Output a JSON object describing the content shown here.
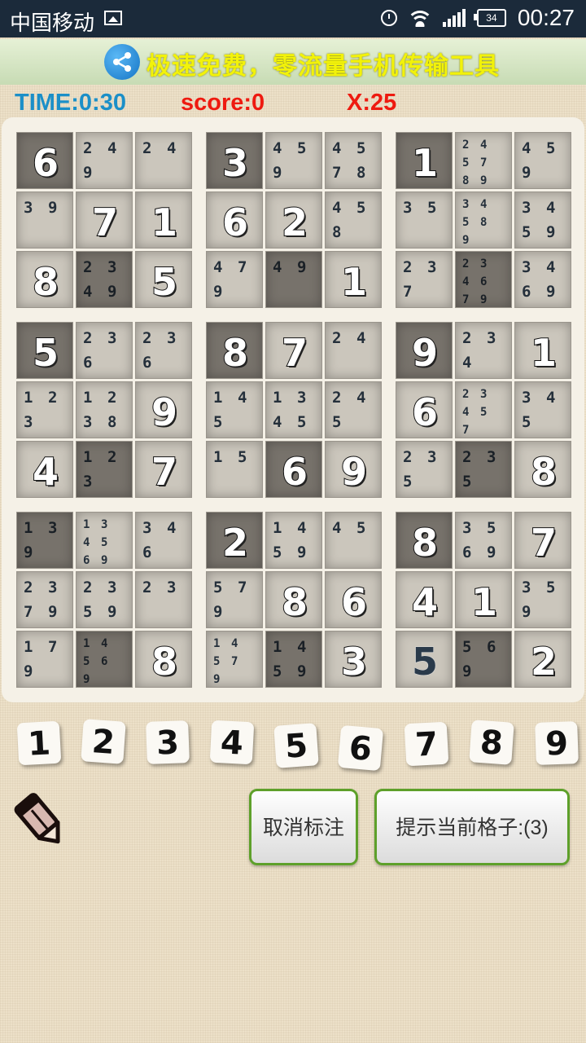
{
  "status_bar": {
    "carrier": "中国移动",
    "battery": "34",
    "time": "00:27",
    "icons": [
      "picture-icon",
      "alarm-clock-icon",
      "wifi-icon",
      "signal-icon",
      "battery-icon"
    ]
  },
  "banner": {
    "text": "极速免费，零流量手机传输工具",
    "icon": "share-icon",
    "text_color": "#f2f20a"
  },
  "hud": {
    "time": "TIME:0:30",
    "score": "score:0",
    "x": "X:25",
    "time_color": "#1b8fc8",
    "score_color": "#ee1a10"
  },
  "board": {
    "blocks": [
      [
        {
          "v": "6"
        },
        {
          "n": [
            "2",
            "4",
            "9"
          ]
        },
        {
          "n": [
            "2",
            "4"
          ]
        },
        {
          "n": [
            "3",
            "9"
          ]
        },
        {
          "v": "7"
        },
        {
          "v": "1"
        },
        {
          "v": "8"
        },
        {
          "n": [
            "2",
            "3",
            "4",
            "9"
          ]
        },
        {
          "v": "5"
        }
      ],
      [
        {
          "v": "3"
        },
        {
          "n": [
            "4",
            "5",
            "9"
          ]
        },
        {
          "n": [
            "4",
            "5",
            "7",
            "8"
          ]
        },
        {
          "v": "6"
        },
        {
          "v": "2"
        },
        {
          "n": [
            "4",
            "5",
            "8"
          ]
        },
        {
          "n": [
            "4",
            "7",
            "9"
          ]
        },
        {
          "n": [
            "4",
            "9"
          ]
        },
        {
          "v": "1"
        }
      ],
      [
        {
          "v": "1"
        },
        {
          "n": [
            "2",
            "4",
            "5",
            "7",
            "8",
            "9"
          ]
        },
        {
          "n": [
            "4",
            "5",
            "9"
          ]
        },
        {
          "n": [
            "3",
            "5"
          ]
        },
        {
          "n": [
            "3",
            "4",
            "5",
            "8",
            "9"
          ]
        },
        {
          "n": [
            "3",
            "4",
            "5",
            "9"
          ]
        },
        {
          "n": [
            "2",
            "3",
            "7"
          ]
        },
        {
          "n": [
            "2",
            "3",
            "4",
            "6",
            "7",
            "9"
          ]
        },
        {
          "n": [
            "3",
            "4",
            "6",
            "9"
          ]
        }
      ],
      [
        {
          "v": "5"
        },
        {
          "n": [
            "2",
            "3",
            "6"
          ]
        },
        {
          "n": [
            "2",
            "3",
            "6"
          ]
        },
        {
          "n": [
            "1",
            "2",
            "3"
          ]
        },
        {
          "n": [
            "1",
            "2",
            "3",
            "8"
          ]
        },
        {
          "v": "9"
        },
        {
          "v": "4"
        },
        {
          "n": [
            "1",
            "2",
            "3"
          ]
        },
        {
          "v": "7"
        }
      ],
      [
        {
          "v": "8"
        },
        {
          "v": "7"
        },
        {
          "n": [
            "2",
            "4"
          ]
        },
        {
          "n": [
            "1",
            "4",
            "5"
          ]
        },
        {
          "n": [
            "1",
            "3",
            "4",
            "5"
          ]
        },
        {
          "n": [
            "2",
            "4",
            "5"
          ]
        },
        {
          "n": [
            "1",
            "5"
          ]
        },
        {
          "v": "6"
        },
        {
          "v": "9"
        }
      ],
      [
        {
          "v": "9"
        },
        {
          "n": [
            "2",
            "3",
            "4"
          ]
        },
        {
          "v": "1"
        },
        {
          "v": "6"
        },
        {
          "n": [
            "2",
            "3",
            "4",
            "5",
            "7"
          ]
        },
        {
          "n": [
            "3",
            "4",
            "5"
          ]
        },
        {
          "n": [
            "2",
            "3",
            "5"
          ]
        },
        {
          "n": [
            "2",
            "3",
            "5"
          ]
        },
        {
          "v": "8"
        }
      ],
      [
        {
          "n": [
            "1",
            "3",
            "9"
          ]
        },
        {
          "n": [
            "1",
            "3",
            "4",
            "5",
            "6",
            "9"
          ]
        },
        {
          "n": [
            "3",
            "4",
            "6"
          ]
        },
        {
          "n": [
            "2",
            "3",
            "7",
            "9"
          ]
        },
        {
          "n": [
            "2",
            "3",
            "5",
            "9"
          ]
        },
        {
          "n": [
            "2",
            "3"
          ]
        },
        {
          "n": [
            "1",
            "7",
            "9"
          ]
        },
        {
          "n": [
            "1",
            "4",
            "5",
            "6",
            "9"
          ]
        },
        {
          "v": "8"
        }
      ],
      [
        {
          "v": "2"
        },
        {
          "n": [
            "1",
            "4",
            "5",
            "9"
          ]
        },
        {
          "n": [
            "4",
            "5"
          ]
        },
        {
          "n": [
            "5",
            "7",
            "9"
          ]
        },
        {
          "v": "8"
        },
        {
          "v": "6"
        },
        {
          "n": [
            "1",
            "4",
            "5",
            "7",
            "9"
          ]
        },
        {
          "n": [
            "1",
            "4",
            "5",
            "9"
          ]
        },
        {
          "v": "3"
        }
      ],
      [
        {
          "v": "8"
        },
        {
          "n": [
            "3",
            "5",
            "6",
            "9"
          ]
        },
        {
          "v": "7"
        },
        {
          "v": "4"
        },
        {
          "v": "1"
        },
        {
          "n": [
            "3",
            "5",
            "9"
          ]
        },
        {
          "v": "5",
          "user": true
        },
        {
          "n": [
            "5",
            "6",
            "9"
          ]
        },
        {
          "v": "2"
        }
      ]
    ]
  },
  "number_pad": [
    "1",
    "2",
    "3",
    "4",
    "5",
    "6",
    "7",
    "8",
    "9"
  ],
  "controls": {
    "pencil_icon": "pencil-icon",
    "cancel_mark": "取消标注",
    "hint": "提示当前格子:(3)",
    "button_border_color": "#5ea02a"
  }
}
